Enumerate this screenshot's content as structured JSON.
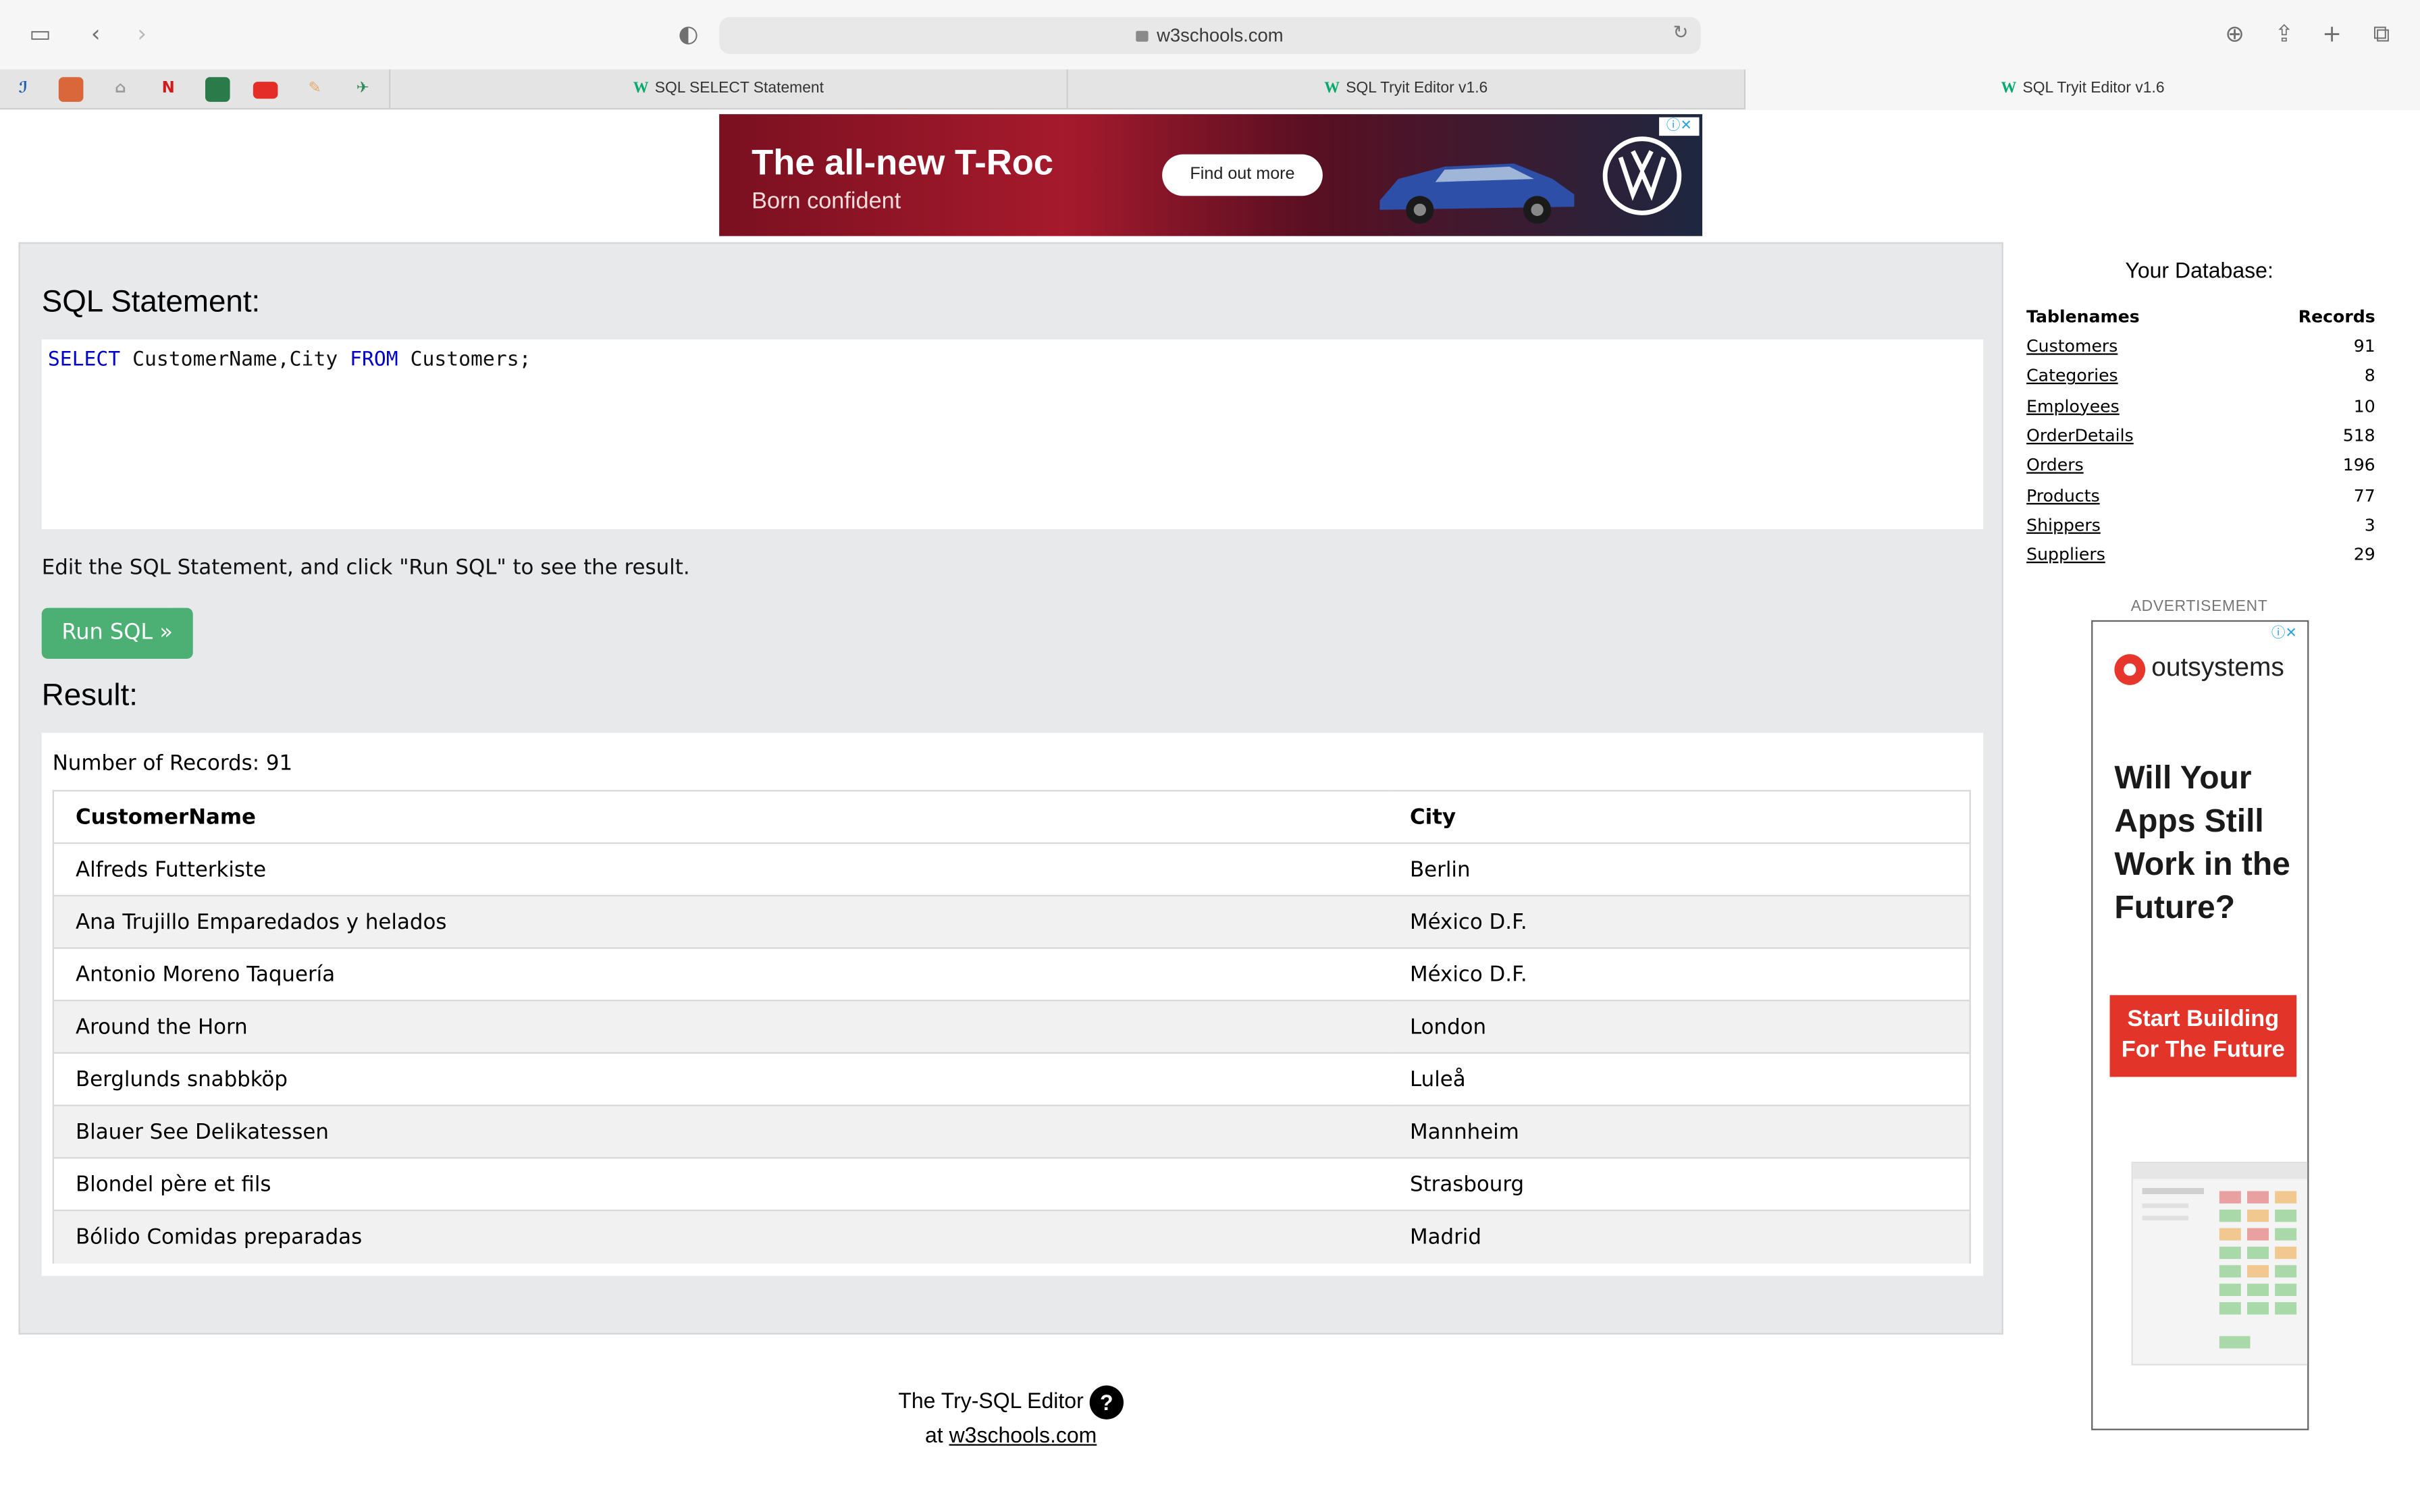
{
  "browser": {
    "url": "w3schools.com",
    "tabs": [
      {
        "label": "SQL SELECT Statement"
      },
      {
        "label": "SQL Tryit Editor v1.6"
      },
      {
        "label": "SQL Tryit Editor v1.6"
      }
    ]
  },
  "ad_banner": {
    "headline": "The all-new T-Roc",
    "subline": "Born confident",
    "cta": "Find out more"
  },
  "editor": {
    "heading": "SQL Statement:",
    "sql_kw1": "SELECT",
    "sql_part1": " CustomerName,City ",
    "sql_kw2": "FROM",
    "sql_part2": " Customers;",
    "note": "Edit the SQL Statement, and click \"Run SQL\" to see the result.",
    "run_label": "Run SQL »"
  },
  "result": {
    "heading": "Result:",
    "count_text": "Number of Records: 91",
    "columns": [
      "CustomerName",
      "City"
    ],
    "rows": [
      [
        "Alfreds Futterkiste",
        "Berlin"
      ],
      [
        "Ana Trujillo Emparedados y helados",
        "México D.F."
      ],
      [
        "Antonio Moreno Taquería",
        "México D.F."
      ],
      [
        "Around the Horn",
        "London"
      ],
      [
        "Berglunds snabbköp",
        "Luleå"
      ],
      [
        "Blauer See Delikatessen",
        "Mannheim"
      ],
      [
        "Blondel père et fils",
        "Strasbourg"
      ],
      [
        "Bólido Comidas preparadas",
        "Madrid"
      ]
    ]
  },
  "footer": {
    "line1": "The Try-SQL Editor",
    "help": "?",
    "at": "at",
    "link": "w3schools.com"
  },
  "database": {
    "title": "Your Database:",
    "col_tables": "Tablenames",
    "col_records": "Records",
    "tables": [
      {
        "name": "Customers",
        "records": "91"
      },
      {
        "name": "Categories",
        "records": "8"
      },
      {
        "name": "Employees",
        "records": "10"
      },
      {
        "name": "OrderDetails",
        "records": "518"
      },
      {
        "name": "Orders",
        "records": "196"
      },
      {
        "name": "Products",
        "records": "77"
      },
      {
        "name": "Shippers",
        "records": "3"
      },
      {
        "name": "Suppliers",
        "records": "29"
      }
    ]
  },
  "side_ad": {
    "label": "ADVERTISEMENT",
    "brand": "outsystems",
    "headline": "Will Your Apps Still Work in the Future?",
    "cta": "Start Building For The Future"
  }
}
